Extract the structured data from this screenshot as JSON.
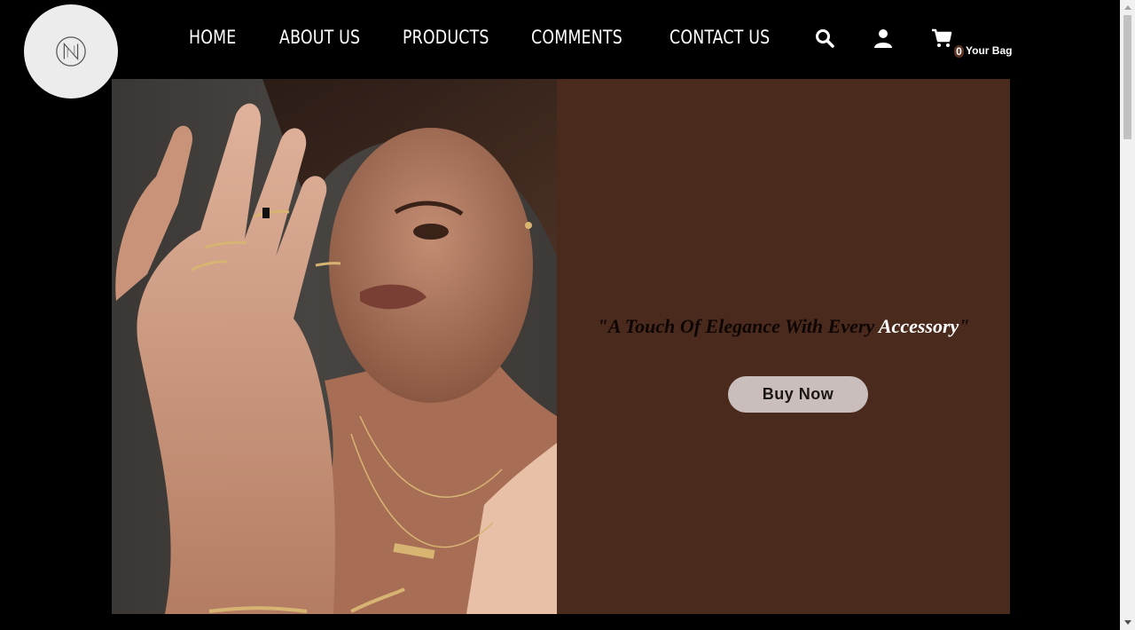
{
  "logo": {
    "icon": "monogram-n-logo"
  },
  "nav": {
    "items": [
      {
        "label": "HOME"
      },
      {
        "label": "ABOUT US"
      },
      {
        "label": "PRODUCTS"
      },
      {
        "label": "COMMENTS"
      },
      {
        "label": "CONTACT US"
      }
    ],
    "icons": [
      "search-icon",
      "user-icon",
      "cart-icon"
    ],
    "bag": {
      "count": "0",
      "label": "Your Bag"
    }
  },
  "hero": {
    "image": "woman-wearing-gold-rings-and-necklaces",
    "tagline_prefix": "\"A Touch Of Elegance With Every ",
    "tagline_accent": "Accessory",
    "tagline_suffix": "\"",
    "button_label": "Buy Now"
  },
  "colors": {
    "background": "#000000",
    "panel": "#4b2a1e",
    "button": "#c9bebb",
    "accent_text": "#ffffff"
  }
}
